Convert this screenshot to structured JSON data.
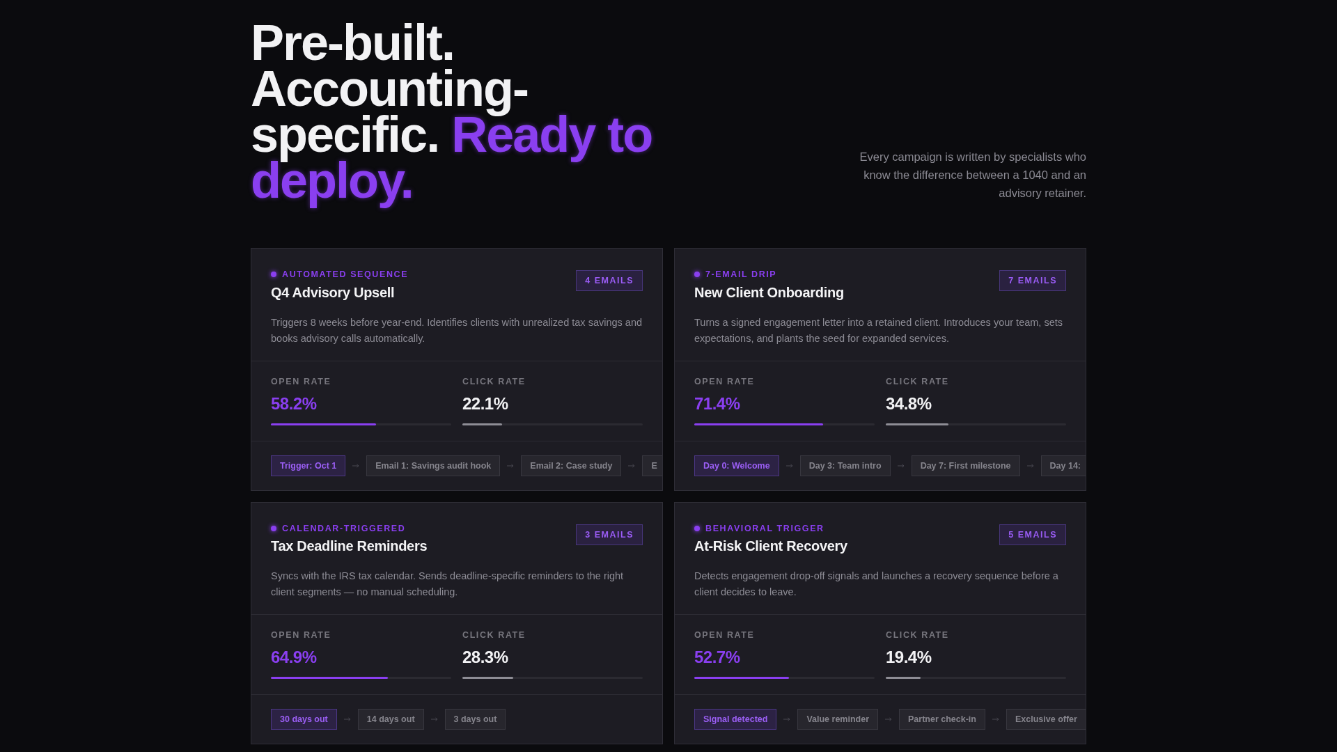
{
  "heading": {
    "lines": [
      "Pre-built.",
      "Accounting-",
      "specific. "
    ],
    "highlight": "Ready to deploy.",
    "subtitle": "Every campaign is written by specialists who know the difference between a 1040 and an advisory retainer."
  },
  "campaigns": [
    {
      "tag": "AUTOMATED SEQUENCE",
      "title": "Q4 Advisory Upsell",
      "count": "4 EMAILS",
      "description": "Triggers 8 weeks before year-end. Identifies clients with unrealized tax savings and books advisory calls automatically.",
      "metrics": [
        {
          "label": "OPEN RATE",
          "value": "58.2%",
          "kind": "open",
          "level": 0.582
        },
        {
          "label": "CLICK RATE",
          "value": "22.1%",
          "kind": "click",
          "level": 0.221
        }
      ],
      "steps": [
        {
          "label": "Trigger: Oct 1",
          "kind": "trigger"
        },
        {
          "label": "Email 1: Savings audit hook",
          "kind": "email"
        },
        {
          "label": "Email 2: Case study",
          "kind": "email"
        },
        {
          "label": "E",
          "kind": "email"
        }
      ]
    },
    {
      "tag": "7-EMAIL DRIP",
      "title": "New Client Onboarding",
      "count": "7 EMAILS",
      "description": "Turns a signed engagement letter into a retained client. Introduces your team, sets expectations, and plants the seed for expanded services.",
      "metrics": [
        {
          "label": "OPEN RATE",
          "value": "71.4%",
          "kind": "open",
          "level": 0.714
        },
        {
          "label": "CLICK RATE",
          "value": "34.8%",
          "kind": "click",
          "level": 0.348
        }
      ],
      "steps": [
        {
          "label": "Day 0: Welcome",
          "kind": "trigger"
        },
        {
          "label": "Day 3: Team intro",
          "kind": "email"
        },
        {
          "label": "Day 7: First milestone",
          "kind": "email"
        },
        {
          "label": "Day 14:",
          "kind": "email"
        }
      ]
    },
    {
      "tag": "CALENDAR-TRIGGERED",
      "title": "Tax Deadline Reminders",
      "count": "3 EMAILS",
      "description": "Syncs with the IRS tax calendar. Sends deadline-specific reminders to the right client segments — no manual scheduling.",
      "metrics": [
        {
          "label": "OPEN RATE",
          "value": "64.9%",
          "kind": "open",
          "level": 0.649
        },
        {
          "label": "CLICK RATE",
          "value": "28.3%",
          "kind": "click",
          "level": 0.283
        }
      ],
      "steps": [
        {
          "label": "30 days out",
          "kind": "trigger"
        },
        {
          "label": "14 days out",
          "kind": "email"
        },
        {
          "label": "3 days out",
          "kind": "email"
        }
      ]
    },
    {
      "tag": "BEHAVIORAL TRIGGER",
      "title": "At-Risk Client Recovery",
      "count": "5 EMAILS",
      "description": "Detects engagement drop-off signals and launches a recovery sequence before a client decides to leave.",
      "metrics": [
        {
          "label": "OPEN RATE",
          "value": "52.7%",
          "kind": "open",
          "level": 0.527
        },
        {
          "label": "CLICK RATE",
          "value": "19.4%",
          "kind": "click",
          "level": 0.194
        }
      ],
      "steps": [
        {
          "label": "Signal detected",
          "kind": "trigger"
        },
        {
          "label": "Value reminder",
          "kind": "email"
        },
        {
          "label": "Partner check-in",
          "kind": "email"
        },
        {
          "label": "Exclusive offer",
          "kind": "email"
        }
      ]
    }
  ]
}
